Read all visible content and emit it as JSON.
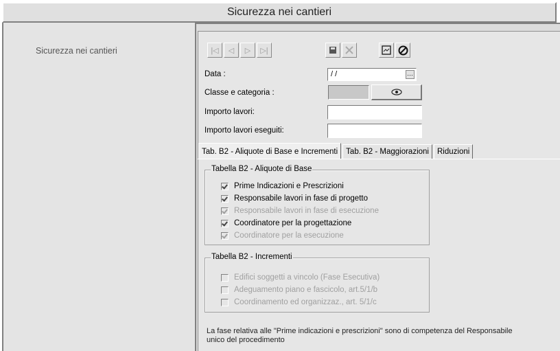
{
  "window": {
    "title": "Sicurezza nei cantieri"
  },
  "sidebar": {
    "items": [
      {
        "label": "Sicurezza nei cantieri"
      }
    ]
  },
  "toolbar": {
    "nav": [
      {
        "name": "first-record-button",
        "glyph": "|◁"
      },
      {
        "name": "prev-record-button",
        "glyph": "◁"
      },
      {
        "name": "next-record-button",
        "glyph": "▷"
      },
      {
        "name": "last-record-button",
        "glyph": "▷|"
      }
    ]
  },
  "form": {
    "data": {
      "label": "Data :",
      "value": " / /"
    },
    "classe": {
      "label": "Classe e categoria :"
    },
    "importo_lavori": {
      "label": "Importo lavori:",
      "value": ""
    },
    "importo_eseguiti": {
      "label": "Importo lavori eseguiti:",
      "value": ""
    }
  },
  "tabs": [
    {
      "label": "Tab. B2 - Aliquote di Base e Incrementi",
      "selected": true
    },
    {
      "label": "Tab. B2 - Maggiorazioni",
      "selected": false
    },
    {
      "label": "Riduzioni",
      "selected": false
    }
  ],
  "group_base": {
    "title": "Tabella B2 - Aliquote di Base",
    "items": [
      {
        "label": "Prime Indicazioni e Prescrizioni",
        "checked": true,
        "enabled": true
      },
      {
        "label": "Responsabile lavori in fase di progetto",
        "checked": true,
        "enabled": true
      },
      {
        "label": "Responsabile lavori in fase di esecuzione",
        "checked": true,
        "enabled": false
      },
      {
        "label": "Coordinatore per la progettazione",
        "checked": true,
        "enabled": true
      },
      {
        "label": "Coordinatore per la esecuzione",
        "checked": true,
        "enabled": false
      }
    ]
  },
  "group_incrementi": {
    "title": "Tabella B2 - Incrementi",
    "items": [
      {
        "label": "Edifici soggetti a vincolo (Fase Esecutiva)",
        "checked": false,
        "enabled": false
      },
      {
        "label": "Adeguamento piano e fascicolo, art.5/1/b",
        "checked": false,
        "enabled": false
      },
      {
        "label": "Coordinamento ed organizzaz., art. 5/1/c",
        "checked": false,
        "enabled": false
      }
    ]
  },
  "note": {
    "line1": "La fase relativa alle \"Prime indicazioni e prescrizioni\" sono di competenza del Responsabile",
    "line2": "unico del procedimento"
  }
}
